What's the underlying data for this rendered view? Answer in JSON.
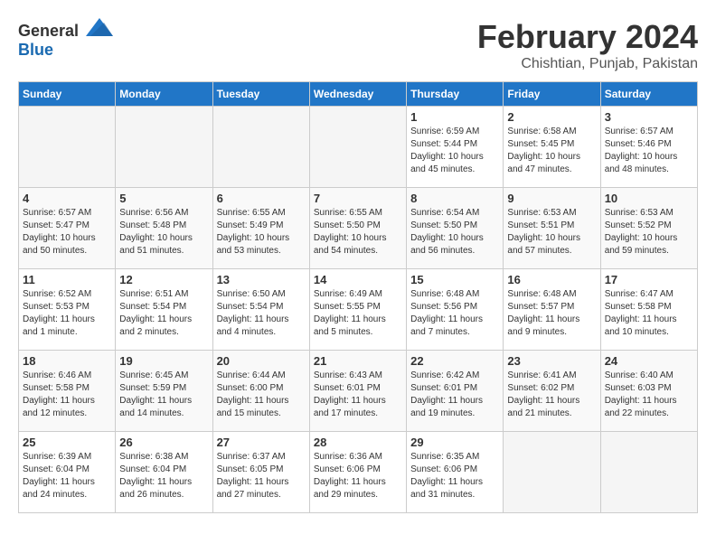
{
  "logo": {
    "general": "General",
    "blue": "Blue"
  },
  "header": {
    "month": "February 2024",
    "location": "Chishtian, Punjab, Pakistan"
  },
  "days_of_week": [
    "Sunday",
    "Monday",
    "Tuesday",
    "Wednesday",
    "Thursday",
    "Friday",
    "Saturday"
  ],
  "weeks": [
    [
      {
        "day": "",
        "info": ""
      },
      {
        "day": "",
        "info": ""
      },
      {
        "day": "",
        "info": ""
      },
      {
        "day": "",
        "info": ""
      },
      {
        "day": "1",
        "info": "Sunrise: 6:59 AM\nSunset: 5:44 PM\nDaylight: 10 hours\nand 45 minutes."
      },
      {
        "day": "2",
        "info": "Sunrise: 6:58 AM\nSunset: 5:45 PM\nDaylight: 10 hours\nand 47 minutes."
      },
      {
        "day": "3",
        "info": "Sunrise: 6:57 AM\nSunset: 5:46 PM\nDaylight: 10 hours\nand 48 minutes."
      }
    ],
    [
      {
        "day": "4",
        "info": "Sunrise: 6:57 AM\nSunset: 5:47 PM\nDaylight: 10 hours\nand 50 minutes."
      },
      {
        "day": "5",
        "info": "Sunrise: 6:56 AM\nSunset: 5:48 PM\nDaylight: 10 hours\nand 51 minutes."
      },
      {
        "day": "6",
        "info": "Sunrise: 6:55 AM\nSunset: 5:49 PM\nDaylight: 10 hours\nand 53 minutes."
      },
      {
        "day": "7",
        "info": "Sunrise: 6:55 AM\nSunset: 5:50 PM\nDaylight: 10 hours\nand 54 minutes."
      },
      {
        "day": "8",
        "info": "Sunrise: 6:54 AM\nSunset: 5:50 PM\nDaylight: 10 hours\nand 56 minutes."
      },
      {
        "day": "9",
        "info": "Sunrise: 6:53 AM\nSunset: 5:51 PM\nDaylight: 10 hours\nand 57 minutes."
      },
      {
        "day": "10",
        "info": "Sunrise: 6:53 AM\nSunset: 5:52 PM\nDaylight: 10 hours\nand 59 minutes."
      }
    ],
    [
      {
        "day": "11",
        "info": "Sunrise: 6:52 AM\nSunset: 5:53 PM\nDaylight: 11 hours\nand 1 minute."
      },
      {
        "day": "12",
        "info": "Sunrise: 6:51 AM\nSunset: 5:54 PM\nDaylight: 11 hours\nand 2 minutes."
      },
      {
        "day": "13",
        "info": "Sunrise: 6:50 AM\nSunset: 5:54 PM\nDaylight: 11 hours\nand 4 minutes."
      },
      {
        "day": "14",
        "info": "Sunrise: 6:49 AM\nSunset: 5:55 PM\nDaylight: 11 hours\nand 5 minutes."
      },
      {
        "day": "15",
        "info": "Sunrise: 6:48 AM\nSunset: 5:56 PM\nDaylight: 11 hours\nand 7 minutes."
      },
      {
        "day": "16",
        "info": "Sunrise: 6:48 AM\nSunset: 5:57 PM\nDaylight: 11 hours\nand 9 minutes."
      },
      {
        "day": "17",
        "info": "Sunrise: 6:47 AM\nSunset: 5:58 PM\nDaylight: 11 hours\nand 10 minutes."
      }
    ],
    [
      {
        "day": "18",
        "info": "Sunrise: 6:46 AM\nSunset: 5:58 PM\nDaylight: 11 hours\nand 12 minutes."
      },
      {
        "day": "19",
        "info": "Sunrise: 6:45 AM\nSunset: 5:59 PM\nDaylight: 11 hours\nand 14 minutes."
      },
      {
        "day": "20",
        "info": "Sunrise: 6:44 AM\nSunset: 6:00 PM\nDaylight: 11 hours\nand 15 minutes."
      },
      {
        "day": "21",
        "info": "Sunrise: 6:43 AM\nSunset: 6:01 PM\nDaylight: 11 hours\nand 17 minutes."
      },
      {
        "day": "22",
        "info": "Sunrise: 6:42 AM\nSunset: 6:01 PM\nDaylight: 11 hours\nand 19 minutes."
      },
      {
        "day": "23",
        "info": "Sunrise: 6:41 AM\nSunset: 6:02 PM\nDaylight: 11 hours\nand 21 minutes."
      },
      {
        "day": "24",
        "info": "Sunrise: 6:40 AM\nSunset: 6:03 PM\nDaylight: 11 hours\nand 22 minutes."
      }
    ],
    [
      {
        "day": "25",
        "info": "Sunrise: 6:39 AM\nSunset: 6:04 PM\nDaylight: 11 hours\nand 24 minutes."
      },
      {
        "day": "26",
        "info": "Sunrise: 6:38 AM\nSunset: 6:04 PM\nDaylight: 11 hours\nand 26 minutes."
      },
      {
        "day": "27",
        "info": "Sunrise: 6:37 AM\nSunset: 6:05 PM\nDaylight: 11 hours\nand 27 minutes."
      },
      {
        "day": "28",
        "info": "Sunrise: 6:36 AM\nSunset: 6:06 PM\nDaylight: 11 hours\nand 29 minutes."
      },
      {
        "day": "29",
        "info": "Sunrise: 6:35 AM\nSunset: 6:06 PM\nDaylight: 11 hours\nand 31 minutes."
      },
      {
        "day": "",
        "info": ""
      },
      {
        "day": "",
        "info": ""
      }
    ]
  ]
}
